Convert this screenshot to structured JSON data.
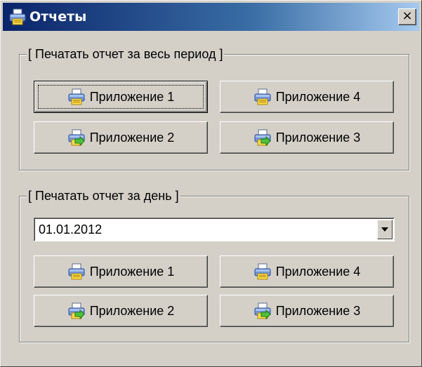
{
  "window": {
    "title": "Отчеты",
    "title_icon": "printer-icon",
    "close_label": "×"
  },
  "period_group": {
    "caption": "[ Печатать отчет за весь период ]",
    "buttons": [
      {
        "label": "Приложение 1",
        "icon": "printer-icon"
      },
      {
        "label": "Приложение 4",
        "icon": "printer-icon"
      },
      {
        "label": "Приложение 2",
        "icon": "printer-export-icon"
      },
      {
        "label": "Приложение 3",
        "icon": "printer-export-icon"
      }
    ]
  },
  "day_group": {
    "caption": "[ Печатать отчет за день ]",
    "date_value": "01.01.2012",
    "buttons": [
      {
        "label": "Приложение 1",
        "icon": "printer-icon"
      },
      {
        "label": "Приложение 4",
        "icon": "printer-icon"
      },
      {
        "label": "Приложение 2",
        "icon": "printer-export-icon"
      },
      {
        "label": "Приложение 3",
        "icon": "printer-export-icon"
      }
    ]
  },
  "colors": {
    "titlebar_start": "#0a246a",
    "titlebar_end": "#a6caf0",
    "face": "#d4d0c8"
  }
}
